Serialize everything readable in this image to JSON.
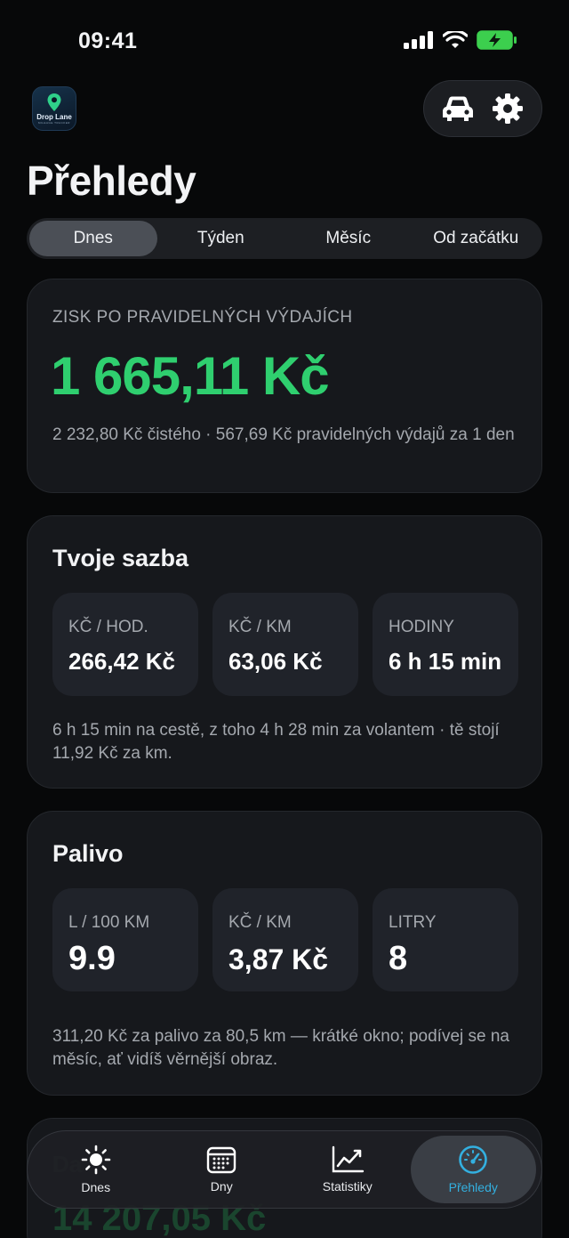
{
  "status": {
    "time": "09:41"
  },
  "app": {
    "brand": "Drop Lane",
    "brand_sub": "MILEAGE TRACKER"
  },
  "page": {
    "title": "Přehledy"
  },
  "segments": [
    {
      "label": "Dnes",
      "active": true
    },
    {
      "label": "Týden",
      "active": false
    },
    {
      "label": "Měsíc",
      "active": false
    },
    {
      "label": "Od začátku",
      "active": false
    }
  ],
  "profit": {
    "label": "ZISK PO PRAVIDELNÝCH VÝDAJÍCH",
    "value": "1 665,11 Kč",
    "note": "2 232,80 Kč čistého · 567,69 Kč pravidelných výdajů za 1 den"
  },
  "rate": {
    "heading": "Tvoje sazba",
    "tiles": [
      {
        "label": "KČ / HOD.",
        "value": "266,42 Kč"
      },
      {
        "label": "KČ / KM",
        "value": "63,06 Kč"
      },
      {
        "label": "HODINY",
        "value": "6 h 15 min"
      }
    ],
    "note": "6 h 15 min na cestě, z toho 4 h 28 min za volantem · tě stojí 11,92 Kč za km."
  },
  "fuel": {
    "heading": "Palivo",
    "tiles": [
      {
        "label": "L / 100 KM",
        "value": "9.9"
      },
      {
        "label": "KČ / KM",
        "value": "3,87 Kč"
      },
      {
        "label": "LITRY",
        "value": "8"
      }
    ],
    "note": "311,20 Kč za palivo za 80,5 km — krátké okno; podívej se na měsíc, ať vidíš věrnější obraz."
  },
  "peek": {
    "title": "Da",
    "value": "14 207,05 Kč"
  },
  "tabbar": [
    {
      "label": "Dnes",
      "icon": "sun-icon",
      "active": false
    },
    {
      "label": "Dny",
      "icon": "calendar-icon",
      "active": false
    },
    {
      "label": "Statistiky",
      "icon": "chart-line-icon",
      "active": false
    },
    {
      "label": "Přehledy",
      "icon": "gauge-icon",
      "active": true
    }
  ],
  "colors": {
    "accent_green": "#2fcf6f",
    "accent_blue": "#33b0e0",
    "background": "#070809",
    "card": "#16181c"
  }
}
